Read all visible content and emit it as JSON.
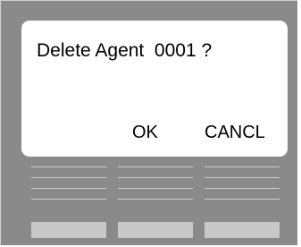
{
  "dialog": {
    "prompt": "Delete Agent  0001 ?",
    "ok_label": "OK",
    "cancel_label": "CANCL"
  },
  "label_rows": 4,
  "hard_keys": [
    "key-1",
    "key-2",
    "key-3"
  ],
  "colors": {
    "bezel": "#8a8a8a",
    "screen": "#ffffff",
    "key": "#c8c8c8",
    "line": "#cfcfcf"
  }
}
